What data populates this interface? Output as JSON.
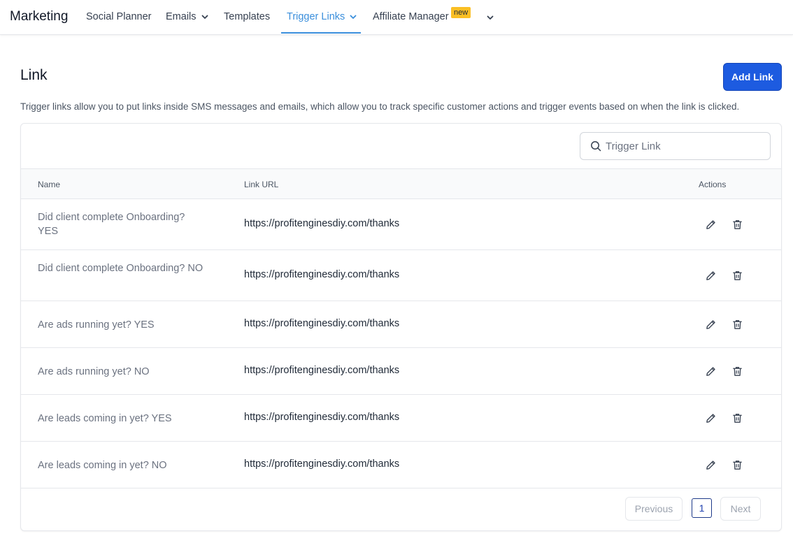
{
  "nav": {
    "brand": "Marketing",
    "items": [
      {
        "label": "Social Planner"
      },
      {
        "label": "Emails"
      },
      {
        "label": "Templates"
      },
      {
        "label": "Trigger Links"
      },
      {
        "label": "Affiliate Manager"
      }
    ],
    "badge": "new",
    "active_color": "#3b8fdc"
  },
  "header": {
    "title": "Link",
    "add_button": "Add Link",
    "description": "Trigger links allow you to put links inside SMS messages and emails, which allow you to track specific customer actions and trigger events based on when the link is clicked."
  },
  "search": {
    "placeholder": "Trigger Link",
    "value": ""
  },
  "table": {
    "columns": [
      "Name",
      "Link URL",
      "Actions"
    ],
    "rows": [
      {
        "name": "Did client complete Onboarding? YES",
        "url": "https://profitenginesdiy.com/thanks"
      },
      {
        "name": "Did client complete Onboarding? NO",
        "url": "https://profitenginesdiy.com/thanks"
      },
      {
        "name": "Are ads running yet? YES",
        "url": "https://profitenginesdiy.com/thanks"
      },
      {
        "name": "Are ads running yet? NO",
        "url": "https://profitenginesdiy.com/thanks"
      },
      {
        "name": "Are leads coming in yet? YES",
        "url": "https://profitenginesdiy.com/thanks"
      },
      {
        "name": "Are leads coming in yet? NO",
        "url": "https://profitenginesdiy.com/thanks"
      }
    ],
    "icons": {
      "edit": "pencil-icon",
      "delete": "trash-icon"
    }
  },
  "pagination": {
    "previous": "Previous",
    "current": "1",
    "next": "Next"
  },
  "colors": {
    "primary_button": "#1d5be0",
    "badge": "#fbbf24"
  }
}
